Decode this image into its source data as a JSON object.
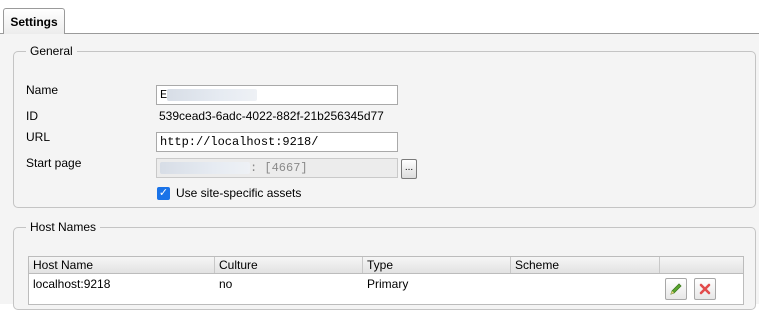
{
  "tabs": [
    {
      "label": "Settings"
    }
  ],
  "general": {
    "legend": "General",
    "name_label": "Name",
    "name_value": "E",
    "id_label": "ID",
    "id_value": "539cead3-6adc-4022-882f-21b256345d77",
    "url_label": "URL",
    "url_value": "http://localhost:9218/",
    "start_page_label": "Start page",
    "start_page_value": ": [4667]",
    "browse_label": "...",
    "use_assets_label": "Use site-specific assets",
    "use_assets_checked": true
  },
  "host_names": {
    "legend": "Host Names",
    "columns": [
      "Host Name",
      "Culture",
      "Type",
      "Scheme"
    ],
    "rows": [
      {
        "host": "localhost:9218",
        "culture": "no",
        "type": "Primary",
        "scheme": ""
      }
    ]
  },
  "icons": {
    "edit": "pencil-icon",
    "delete": "delete-x-icon",
    "checkbox": "checkmark-icon"
  },
  "colors": {
    "panel_bg": "#f4f4f4",
    "checkbox_accent": "#1a73e8",
    "edit_green": "#5aa62e",
    "delete_red": "#e24b4b"
  }
}
